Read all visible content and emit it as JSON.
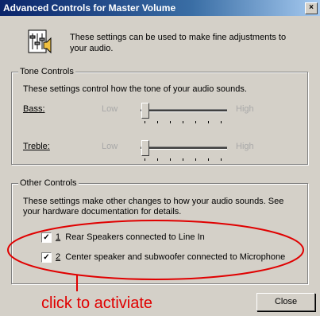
{
  "window": {
    "title": "Advanced Controls for Master Volume",
    "close_glyph": "×"
  },
  "intro": {
    "icon": "speaker-settings-icon",
    "text": "These settings can be used to make fine adjustments to your audio."
  },
  "tone": {
    "title": "Tone Controls",
    "description": "These settings control how the tone of your audio sounds.",
    "bass": {
      "label": "Bass:",
      "low": "Low",
      "high": "High",
      "level": 0
    },
    "treble": {
      "label": "Treble:",
      "low": "Low",
      "high": "High",
      "level": 0
    }
  },
  "other": {
    "title": "Other Controls",
    "description": "These settings make other changes to how your audio sounds.  See your hardware documentation for details.",
    "options": [
      {
        "number": "1",
        "label": "Rear Speakers connected to Line In",
        "checked": true
      },
      {
        "number": "2",
        "label": "Center speaker and subwoofer connected to Microphone",
        "checked": true
      }
    ]
  },
  "buttons": {
    "close": "Close"
  },
  "annotation": {
    "text": "click to activiate",
    "color": "#e00000"
  }
}
